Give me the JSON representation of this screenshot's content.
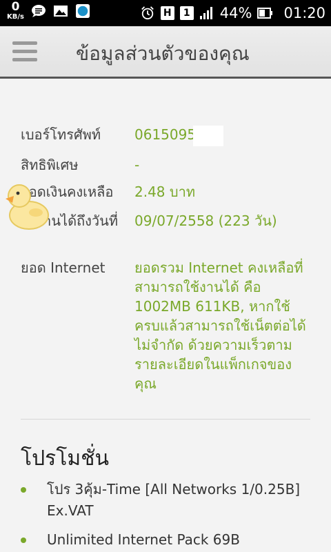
{
  "statusbar": {
    "net_speed_value": "0",
    "net_speed_unit": "KB/s",
    "sim1": "H",
    "sim2": "1",
    "battery_percent": "44%",
    "time": "01:20"
  },
  "header": {
    "title": "ข้อมูลส่วนตัวของคุณ"
  },
  "info": {
    "phone": {
      "label": "เบอร์โทรศัพท์",
      "value": "0615095"
    },
    "privilege": {
      "label": "สิทธิพิเศษ",
      "value": "-"
    },
    "balance": {
      "label": "ยอดเงินคงเหลือ",
      "value": "2.48 บาท"
    },
    "valid_until": {
      "label": "ใช้งานได้ถึงวันที่",
      "value": "09/07/2558 (223 วัน)"
    },
    "internet": {
      "label": "ยอด Internet",
      "value": "ยอดรวม Internet คงเหลือที่สามารถใช้งานได้ คือ 1002MB 611KB, หากใช้ครบแล้วสามารถใช้เน็ตต่อได้ไม่จำกัด ด้วยความเร็วตามรายละเอียดในแพ็กเกจของคุณ"
    }
  },
  "promotions": {
    "title": "โปรโมชั่น",
    "items": [
      "โปร 3คุ้ม-Time [All Networks 1/0.25B] Ex.VAT",
      "Unlimited Internet Pack 69B"
    ]
  },
  "colors": {
    "accent_green": "#7aa82a",
    "status_bar": "#000000",
    "header_bg": "#e6e6e6"
  }
}
